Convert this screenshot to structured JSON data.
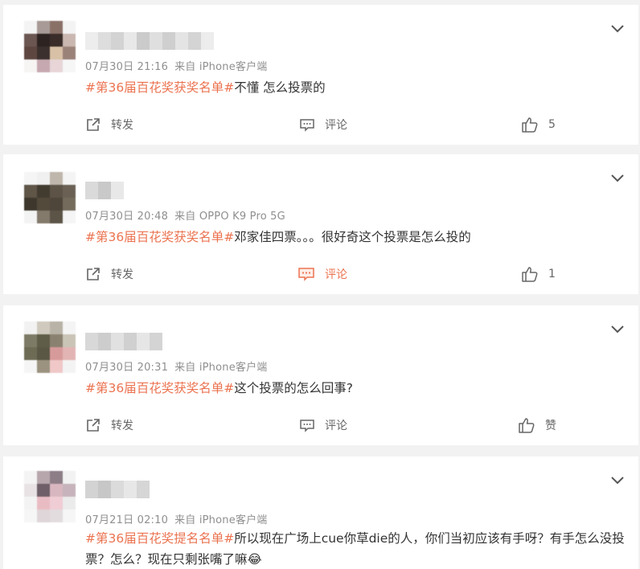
{
  "posts": [
    {
      "time": "07月30日 21:16",
      "source": "来自 iPhone客户端",
      "topic": "#第36届百花奖获奖名单#",
      "text": "不懂 怎么投票的",
      "actions": {
        "repost": "转发",
        "comment": "评论",
        "like_count": "5"
      }
    },
    {
      "time": "07月30日 20:48",
      "source": "来自 OPPO K9 Pro 5G",
      "topic": "#第36届百花奖获奖名单#",
      "text": "邓家佳四票。。。很好奇这个投票是怎么投的",
      "actions": {
        "repost": "转发",
        "comment": "评论",
        "like_count": "1"
      }
    },
    {
      "time": "07月30日 20:31",
      "source": "来自 iPhone客户端",
      "topic": "#第36届百花奖获奖名单#",
      "text": "这个投票的怎么回事?",
      "actions": {
        "repost": "转发",
        "comment": "评论",
        "like_label": "赞"
      }
    },
    {
      "time": "07月21日 02:10",
      "source": "来自 iPhone客户端",
      "topic": "#第36届百花奖提名名单#",
      "text": "所以现在广场上cue你草die的人，你们当初应该有手呀？有手怎么没投票？怎么？现在只剩张嘴了嘛😂"
    }
  ],
  "colors": {
    "accent": "#eb7350",
    "meta": "#8f8f8f",
    "text": "#333333"
  },
  "icons": {
    "repost": "share-icon",
    "comment": "comment-icon",
    "like": "thumbs-up-icon",
    "menu": "chevron-down-icon"
  }
}
